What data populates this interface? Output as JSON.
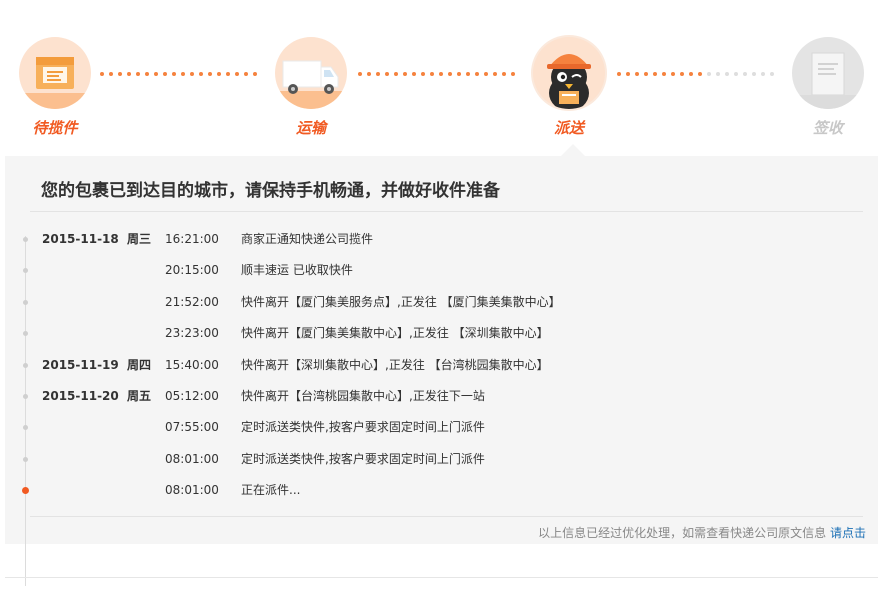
{
  "steps": [
    {
      "label": "待揽件",
      "state": "done",
      "icon": "package-box-icon"
    },
    {
      "label": "运输",
      "state": "done",
      "icon": "delivery-truck-icon"
    },
    {
      "label": "派送",
      "state": "current",
      "icon": "courier-mascot-icon"
    },
    {
      "label": "签收",
      "state": "todo",
      "icon": "signed-document-icon"
    }
  ],
  "headline": "您的包裹已到达目的城市，请保持手机畅通，并做好收件准备",
  "events": [
    {
      "date": "2015-11-18",
      "day": "周三",
      "time": "16:21:00",
      "desc": "商家正通知快递公司揽件"
    },
    {
      "date": "",
      "day": "",
      "time": "20:15:00",
      "desc": "顺丰速运 已收取快件"
    },
    {
      "date": "",
      "day": "",
      "time": "21:52:00",
      "desc": "快件离开【厦门集美服务点】,正发往 【厦门集美集散中心】"
    },
    {
      "date": "",
      "day": "",
      "time": "23:23:00",
      "desc": "快件离开【厦门集美集散中心】,正发往 【深圳集散中心】"
    },
    {
      "date": "2015-11-19",
      "day": "周四",
      "time": "15:40:00",
      "desc": "快件离开【深圳集散中心】,正发往 【台湾桃园集散中心】"
    },
    {
      "date": "2015-11-20",
      "day": "周五",
      "time": "05:12:00",
      "desc": "快件离开【台湾桃园集散中心】,正发往下一站"
    },
    {
      "date": "",
      "day": "",
      "time": "07:55:00",
      "desc": "定时派送类快件,按客户要求固定时间上门派件"
    },
    {
      "date": "",
      "day": "",
      "time": "08:01:00",
      "desc": "定时派送类快件,按客户要求固定时间上门派件"
    },
    {
      "date": "",
      "day": "",
      "time": "08:01:00",
      "desc": "正在派件..."
    }
  ],
  "footer": {
    "note": "以上信息已经过优化处理，如需查看快递公司原文信息 ",
    "link": "请点击"
  },
  "colors": {
    "accent": "#f15a22",
    "accent_light": "#fde2cf",
    "inactive": "#c8c8c8",
    "panel_bg": "#f5f5f5",
    "link": "#1a6fb5"
  }
}
